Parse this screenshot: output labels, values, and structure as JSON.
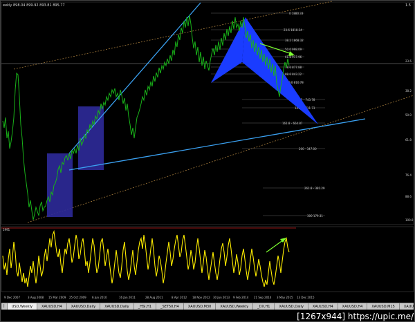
{
  "chart": {
    "header": "eekly 898.04 899.92 893.81 895.77",
    "header_right": "1.5",
    "osc_label": "1991",
    "fib_levels": [
      {
        "label": "0 1880.33"
      },
      {
        "label": "23.6 1818.34"
      },
      {
        "label": "38.2 1868.32"
      },
      {
        "label": "50.0 998.09"
      },
      {
        "label": "61.8 917.96"
      },
      {
        "label": "78.6 877.88"
      },
      {
        "label": "88.6 843.22"
      },
      {
        "label": "100.0 810.78"
      },
      {
        "label": "127.2 - 743.78"
      },
      {
        "label": "141.4 - 711.73"
      },
      {
        "label": "161.8 - 664.87"
      },
      {
        "label": "200 - 347.00"
      },
      {
        "label": "261.8 - 381.29"
      },
      {
        "label": "300 179.31"
      }
    ],
    "right_levels": [
      "23.6",
      "38.2",
      "50.0",
      "61.8",
      "76.4",
      "88.6",
      "100.0"
    ],
    "x_axis_labels": [
      "9 Dec 2007",
      "3 Aug 2008",
      "15 Mar 2009",
      "25 Oct 2009",
      "6 Jun 2010",
      "16 Jan 2011",
      "28 Aug 2011",
      "8 Apr 2012",
      "18 Nov 2012",
      "30 Jun 2013",
      "9 Feb 2014",
      "21 Sep 2014",
      "3 May 2015",
      "13 Dec 2015"
    ]
  },
  "tabs": [
    "USD,Weekly",
    "XAUUSD,H4",
    "XAUUSD,Daily",
    "XAUUSD,Daily",
    "_HSI,H1",
    "_SET50,H4",
    "XAUUSD,M30",
    "XAUUSD,Weekly",
    "_DX,H1",
    "XAUUSD,Daily",
    "XAUUSD,H4",
    "XAUUSD,H4",
    "XAUUSD,M15",
    "XAUUSD,M15"
  ],
  "active_tab_index": 0,
  "watermark": "[1267x944] https://upic.me/",
  "colors": {
    "price": "#19b319",
    "oscillator": "#ffee00",
    "pattern": "#1a3cff",
    "box": "#2e2a9a",
    "trendline": "#3aa0f0",
    "channel": "#a67c3c",
    "arrow": "#7dff30"
  }
}
